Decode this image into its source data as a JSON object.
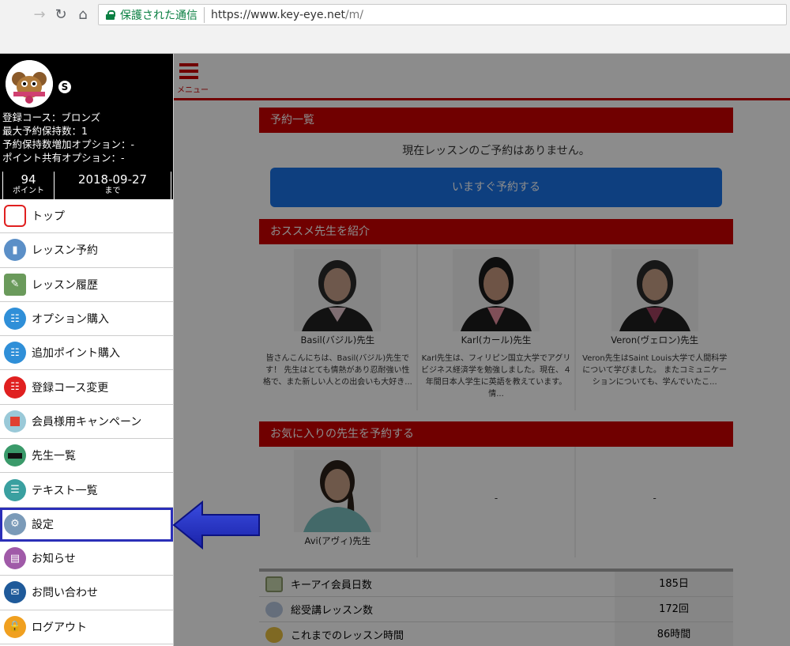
{
  "browser": {
    "secure_label": "保護された通信",
    "url_host": "https://www.key-eye.net",
    "url_path": "/m/"
  },
  "profile": {
    "badge": "S",
    "course": "登録コース：ブロンズ",
    "max_reservations": "最大予約保持数：1",
    "reservation_option": "予約保持数増加オプション：-",
    "point_share_option": "ポイント共有オプション：-",
    "points_value": "94",
    "points_label": "ポイント",
    "expiry_value": "2018-09-27",
    "expiry_label": "まで"
  },
  "menu": {
    "items": [
      {
        "label": "トップ",
        "icon": "speech-bubble-icon",
        "color": "#e02020"
      },
      {
        "label": "レッスン予約",
        "icon": "phone-icon",
        "color": "#5b8fc7"
      },
      {
        "label": "レッスン履歴",
        "icon": "notebook-icon",
        "color": "#6a9a5b"
      },
      {
        "label": "オプション購入",
        "icon": "cart-icon",
        "color": "#2f8fd8"
      },
      {
        "label": "追加ポイント購入",
        "icon": "cart-icon",
        "color": "#2f8fd8"
      },
      {
        "label": "登録コース変更",
        "icon": "cart-icon",
        "color": "#e02020"
      },
      {
        "label": "会員様用キャンペーン",
        "icon": "gift-icon",
        "color": "#9ac9d8"
      },
      {
        "label": "先生一覧",
        "icon": "graduation-cap-icon",
        "color": "#3a9a6a"
      },
      {
        "label": "テキスト一覧",
        "icon": "books-icon",
        "color": "#3aa0a0"
      },
      {
        "label": "設定",
        "icon": "gear-icon",
        "color": "#7a9ab8"
      },
      {
        "label": "お知らせ",
        "icon": "news-icon",
        "color": "#a05aa8"
      },
      {
        "label": "お問い合わせ",
        "icon": "mail-icon",
        "color": "#1f5a9a"
      },
      {
        "label": "ログアウト",
        "icon": "lock-icon",
        "color": "#f0a020"
      }
    ]
  },
  "topbar": {
    "menu_label": "メニュー"
  },
  "reservations": {
    "title": "予約一覧",
    "empty_message": "現在レッスンのご予約はありません。",
    "book_button": "いますぐ予約する"
  },
  "recommended": {
    "title": "おススメ先生を紹介",
    "teachers": [
      {
        "name": "Basil(バジル)先生",
        "desc": "皆さんこんにちは、Basil(バジル)先生です！ 先生はとても情熱があり忍耐強い性格で、また新しい人との出会いも大好き..."
      },
      {
        "name": "Karl(カール)先生",
        "desc": "Karl先生は、フィリピン国立大学でアグリビジネス経済学を勉強しました。現在、４年間日本人学生に英語を教えています。 情..."
      },
      {
        "name": "Veron(ヴェロン)先生",
        "desc": "Veron先生はSaint Louis大学で人間科学について学びました。 またコミュニケーションについても、学んでいたこ..."
      }
    ]
  },
  "favorites": {
    "title": "お気に入りの先生を予約する",
    "teacher_name": "Avi(アヴィ)先生",
    "empty1": "-",
    "empty2": "-"
  },
  "stats": {
    "rows": [
      {
        "label": "キーアイ会員日数",
        "value": "185日",
        "icon": "calendar-icon"
      },
      {
        "label": "総受講レッスン数",
        "value": "172回",
        "icon": "lessons-icon"
      },
      {
        "label": "これまでのレッスン時間",
        "value": "86時間",
        "icon": "clock-icon"
      }
    ]
  }
}
